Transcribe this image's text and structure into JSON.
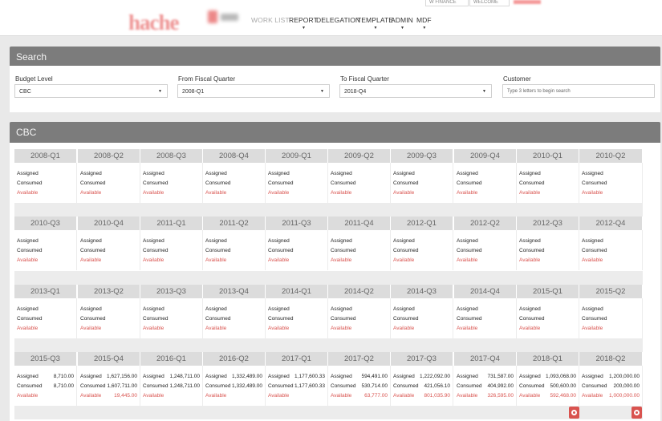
{
  "header": {
    "logo_text": "hache",
    "top_right": [
      "W FINANCE",
      "WELCOME"
    ],
    "nav": [
      {
        "label": "WORK LIST",
        "caret": false
      },
      {
        "label": "REPORT",
        "caret": true
      },
      {
        "label": "DELEGATION",
        "caret": false
      },
      {
        "label": "TEMPLATE",
        "caret": true
      },
      {
        "label": "ADMIN",
        "caret": true
      },
      {
        "label": "MDF",
        "caret": true
      }
    ],
    "caret_glyph": "▼"
  },
  "search": {
    "title": "Search",
    "budget_level": {
      "label": "Budget Level",
      "value": "CBC"
    },
    "from_quarter": {
      "label": "From Fiscal Quarter",
      "value": "2008-Q1"
    },
    "to_quarter": {
      "label": "To Fiscal Quarter",
      "value": "2018-Q4"
    },
    "customer": {
      "label": "Customer",
      "placeholder": "Type 3 letters to begin search"
    },
    "arrow_glyph": "▼"
  },
  "results": {
    "title": "CBC",
    "row_labels": {
      "assigned": "Assigned",
      "consumed": "Consumed",
      "available": "Available"
    },
    "quarters": [
      {
        "q": "2008-Q1"
      },
      {
        "q": "2008-Q2"
      },
      {
        "q": "2008-Q3"
      },
      {
        "q": "2008-Q4"
      },
      {
        "q": "2009-Q1"
      },
      {
        "q": "2009-Q2"
      },
      {
        "q": "2009-Q3"
      },
      {
        "q": "2009-Q4"
      },
      {
        "q": "2010-Q1"
      },
      {
        "q": "2010-Q2"
      },
      {
        "q": "2010-Q3"
      },
      {
        "q": "2010-Q4"
      },
      {
        "q": "2011-Q1"
      },
      {
        "q": "2011-Q2"
      },
      {
        "q": "2011-Q3"
      },
      {
        "q": "2011-Q4"
      },
      {
        "q": "2012-Q1"
      },
      {
        "q": "2012-Q2"
      },
      {
        "q": "2012-Q3"
      },
      {
        "q": "2012-Q4"
      },
      {
        "q": "2013-Q1"
      },
      {
        "q": "2013-Q2"
      },
      {
        "q": "2013-Q3"
      },
      {
        "q": "2013-Q4"
      },
      {
        "q": "2014-Q1"
      },
      {
        "q": "2014-Q2"
      },
      {
        "q": "2014-Q3"
      },
      {
        "q": "2014-Q4"
      },
      {
        "q": "2015-Q1"
      },
      {
        "q": "2015-Q2"
      },
      {
        "q": "2015-Q3",
        "assigned": "8,710.00",
        "consumed": "8,710.00",
        "available": ""
      },
      {
        "q": "2015-Q4",
        "assigned": "1,627,156.00",
        "consumed": "1,607,711.00",
        "available": "19,445.00"
      },
      {
        "q": "2016-Q1",
        "assigned": "1,248,711.00",
        "consumed": "1,248,711.00",
        "available": ""
      },
      {
        "q": "2016-Q2",
        "assigned": "1,332,489.00",
        "consumed": "1,332,489.00",
        "available": ""
      },
      {
        "q": "2017-Q1",
        "assigned": "1,177,600.33",
        "consumed": "1,177,600.33",
        "available": ""
      },
      {
        "q": "2017-Q2",
        "assigned": "594,491.00",
        "consumed": "530,714.00",
        "available": "63,777.00"
      },
      {
        "q": "2017-Q3",
        "assigned": "1,222,092.00",
        "consumed": "421,056.10",
        "available": "801,035.90"
      },
      {
        "q": "2017-Q4",
        "assigned": "731,587.00",
        "consumed": "404,992.00",
        "available": "326,595.00"
      },
      {
        "q": "2018-Q1",
        "assigned": "1,093,068.00",
        "consumed": "500,600.00",
        "available": "592,468.00"
      },
      {
        "q": "2018-Q2",
        "assigned": "1,200,000.00",
        "consumed": "200,000.00",
        "available": "1,000,000.00"
      }
    ]
  },
  "colors": {
    "header_bar": "#7c7c7c",
    "quarter_header": "#dcdcdc",
    "available_red": "#d9534f",
    "plus_button": "#d9534f"
  },
  "icons": {
    "expand": "plus-circle-icon"
  }
}
